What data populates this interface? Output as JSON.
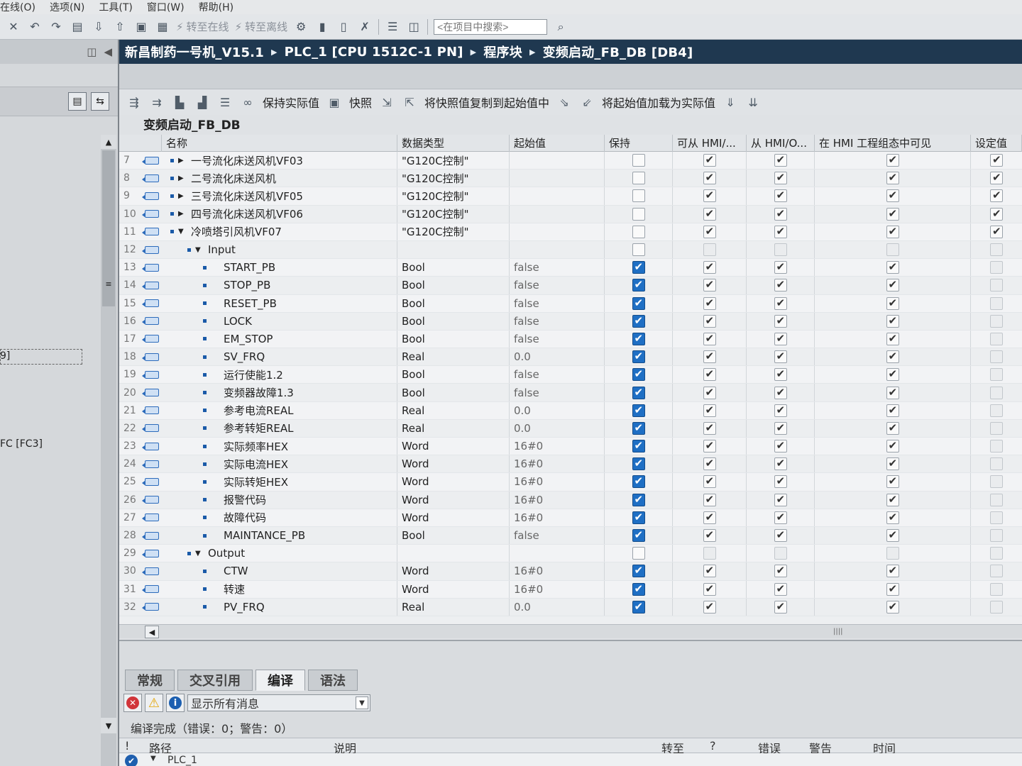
{
  "menubar": [
    "在线(O)",
    "选项(N)",
    "工具(T)",
    "窗口(W)",
    "帮助(H)"
  ],
  "toolbar": {
    "go_online": "转至在线",
    "go_offline": "转至离线",
    "search_placeholder": "<在项目中搜索>"
  },
  "left_panel": {
    "item_partial_1": "9]",
    "item_partial_2": "FC [FC3]"
  },
  "breadcrumb": [
    "新昌制药一号机_V15.1",
    "PLC_1 [CPU 1512C-1 PN]",
    "程序块",
    "变频启动_FB_DB [DB4]"
  ],
  "db_toolbar": {
    "keep_actual": "保持实际值",
    "snapshot": "快照",
    "copy_snapshot": "将快照值复制到起始值中",
    "load_start": "将起始值加载为实际值"
  },
  "db_title": "变频启动_FB_DB",
  "columns": {
    "name": "名称",
    "datatype": "数据类型",
    "start": "起始值",
    "retain": "保持",
    "hmi_access": "可从 HMI/...",
    "hmi_write": "从 HMI/O...",
    "hmi_visible": "在 HMI 工程组态中可见",
    "setpoint": "设定值"
  },
  "rows": [
    {
      "n": "7",
      "indent": 0,
      "toggle": "right",
      "name": "一号流化床送风机VF03",
      "type": "\"G120C控制\"",
      "start": "",
      "retain": "empty",
      "h1": "on",
      "h2": "on",
      "h3": "on",
      "sp": "on"
    },
    {
      "n": "8",
      "indent": 0,
      "toggle": "right",
      "name": "二号流化床送风机",
      "type": "\"G120C控制\"",
      "start": "",
      "retain": "empty",
      "h1": "on",
      "h2": "on",
      "h3": "on",
      "sp": "on"
    },
    {
      "n": "9",
      "indent": 0,
      "toggle": "right",
      "name": "三号流化床送风机VF05",
      "type": "\"G120C控制\"",
      "start": "",
      "retain": "empty",
      "h1": "on",
      "h2": "on",
      "h3": "on",
      "sp": "on"
    },
    {
      "n": "10",
      "indent": 0,
      "toggle": "right",
      "name": "四号流化床送风机VF06",
      "type": "\"G120C控制\"",
      "start": "",
      "retain": "empty",
      "h1": "on",
      "h2": "on",
      "h3": "on",
      "sp": "on"
    },
    {
      "n": "11",
      "indent": 0,
      "toggle": "down",
      "name": "冷喷塔引风机VF07",
      "type": "\"G120C控制\"",
      "start": "",
      "retain": "empty",
      "h1": "on",
      "h2": "on",
      "h3": "on",
      "sp": "on"
    },
    {
      "n": "12",
      "indent": 1,
      "toggle": "down",
      "name": "Input",
      "type": "",
      "start": "",
      "retain": "empty",
      "h1": "dis",
      "h2": "dis",
      "h3": "dis",
      "sp": "dis"
    },
    {
      "n": "13",
      "indent": 2,
      "toggle": "",
      "name": "START_PB",
      "type": "Bool",
      "start": "false",
      "retain": "blue",
      "h1": "on",
      "h2": "on",
      "h3": "on",
      "sp": "dis"
    },
    {
      "n": "14",
      "indent": 2,
      "toggle": "",
      "name": "STOP_PB",
      "type": "Bool",
      "start": "false",
      "retain": "blue",
      "h1": "on",
      "h2": "on",
      "h3": "on",
      "sp": "dis"
    },
    {
      "n": "15",
      "indent": 2,
      "toggle": "",
      "name": "RESET_PB",
      "type": "Bool",
      "start": "false",
      "retain": "blue",
      "h1": "on",
      "h2": "on",
      "h3": "on",
      "sp": "dis"
    },
    {
      "n": "16",
      "indent": 2,
      "toggle": "",
      "name": "LOCK",
      "type": "Bool",
      "start": "false",
      "retain": "blue",
      "h1": "on",
      "h2": "on",
      "h3": "on",
      "sp": "dis"
    },
    {
      "n": "17",
      "indent": 2,
      "toggle": "",
      "name": "EM_STOP",
      "type": "Bool",
      "start": "false",
      "retain": "blue",
      "h1": "on",
      "h2": "on",
      "h3": "on",
      "sp": "dis"
    },
    {
      "n": "18",
      "indent": 2,
      "toggle": "",
      "name": "SV_FRQ",
      "type": "Real",
      "start": "0.0",
      "retain": "blue",
      "h1": "on",
      "h2": "on",
      "h3": "on",
      "sp": "dis"
    },
    {
      "n": "19",
      "indent": 2,
      "toggle": "",
      "name": "运行使能1.2",
      "type": "Bool",
      "start": "false",
      "retain": "blue",
      "h1": "on",
      "h2": "on",
      "h3": "on",
      "sp": "dis"
    },
    {
      "n": "20",
      "indent": 2,
      "toggle": "",
      "name": "变频器故障1.3",
      "type": "Bool",
      "start": "false",
      "retain": "blue",
      "h1": "on",
      "h2": "on",
      "h3": "on",
      "sp": "dis"
    },
    {
      "n": "21",
      "indent": 2,
      "toggle": "",
      "name": "参考电流REAL",
      "type": "Real",
      "start": "0.0",
      "retain": "blue",
      "h1": "on",
      "h2": "on",
      "h3": "on",
      "sp": "dis"
    },
    {
      "n": "22",
      "indent": 2,
      "toggle": "",
      "name": "参考转矩REAL",
      "type": "Real",
      "start": "0.0",
      "retain": "blue",
      "h1": "on",
      "h2": "on",
      "h3": "on",
      "sp": "dis"
    },
    {
      "n": "23",
      "indent": 2,
      "toggle": "",
      "name": "实际频率HEX",
      "type": "Word",
      "start": "16#0",
      "retain": "blue",
      "h1": "on",
      "h2": "on",
      "h3": "on",
      "sp": "dis"
    },
    {
      "n": "24",
      "indent": 2,
      "toggle": "",
      "name": "实际电流HEX",
      "type": "Word",
      "start": "16#0",
      "retain": "blue",
      "h1": "on",
      "h2": "on",
      "h3": "on",
      "sp": "dis"
    },
    {
      "n": "25",
      "indent": 2,
      "toggle": "",
      "name": "实际转矩HEX",
      "type": "Word",
      "start": "16#0",
      "retain": "blue",
      "h1": "on",
      "h2": "on",
      "h3": "on",
      "sp": "dis"
    },
    {
      "n": "26",
      "indent": 2,
      "toggle": "",
      "name": "报警代码",
      "type": "Word",
      "start": "16#0",
      "retain": "blue",
      "h1": "on",
      "h2": "on",
      "h3": "on",
      "sp": "dis"
    },
    {
      "n": "27",
      "indent": 2,
      "toggle": "",
      "name": "故障代码",
      "type": "Word",
      "start": "16#0",
      "retain": "blue",
      "h1": "on",
      "h2": "on",
      "h3": "on",
      "sp": "dis"
    },
    {
      "n": "28",
      "indent": 2,
      "toggle": "",
      "name": "MAINTANCE_PB",
      "type": "Bool",
      "start": "false",
      "retain": "blue",
      "h1": "on",
      "h2": "on",
      "h3": "on",
      "sp": "dis"
    },
    {
      "n": "29",
      "indent": 1,
      "toggle": "down",
      "name": "Output",
      "type": "",
      "start": "",
      "retain": "empty",
      "h1": "dis",
      "h2": "dis",
      "h3": "dis",
      "sp": "dis"
    },
    {
      "n": "30",
      "indent": 2,
      "toggle": "",
      "name": "CTW",
      "type": "Word",
      "start": "16#0",
      "retain": "blue",
      "h1": "on",
      "h2": "on",
      "h3": "on",
      "sp": "dis"
    },
    {
      "n": "31",
      "indent": 2,
      "toggle": "",
      "name": "转速",
      "type": "Word",
      "start": "16#0",
      "retain": "blue",
      "h1": "on",
      "h2": "on",
      "h3": "on",
      "sp": "dis"
    },
    {
      "n": "32",
      "indent": 2,
      "toggle": "",
      "name": "PV_FRQ",
      "type": "Real",
      "start": "0.0",
      "retain": "blue",
      "h1": "on",
      "h2": "on",
      "h3": "on",
      "sp": "dis"
    }
  ],
  "inspector": {
    "tabs": [
      "常规",
      "交叉引用",
      "编译",
      "语法"
    ],
    "active_tab": "编译",
    "filter": "显示所有消息",
    "status": "编译完成（错误：0；警告：0）",
    "headers": {
      "bang": "!",
      "path": "路径",
      "desc": "说明",
      "goto": "转至",
      "q": "?",
      "err": "错误",
      "warn": "警告",
      "time": "时间"
    },
    "row_path": "PLC_1"
  }
}
